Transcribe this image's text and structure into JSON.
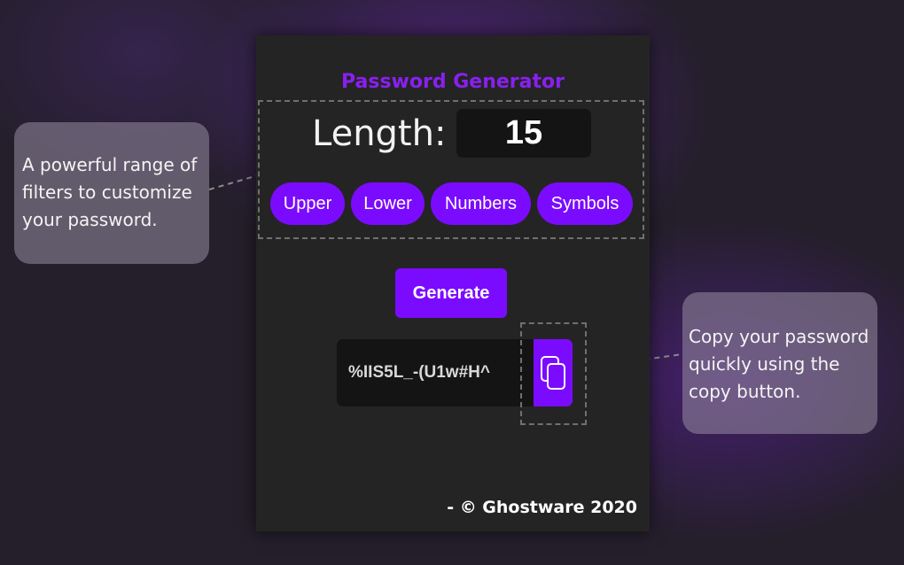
{
  "app": {
    "title": "Password Generator"
  },
  "length": {
    "label": "Length:",
    "value": "15"
  },
  "filters": [
    {
      "id": "upper",
      "label": "Upper"
    },
    {
      "id": "lower",
      "label": "Lower"
    },
    {
      "id": "numbers",
      "label": "Numbers"
    },
    {
      "id": "symbols",
      "label": "Symbols"
    }
  ],
  "generate": {
    "label": "Generate"
  },
  "password": {
    "value": "%IIS5L_-(U1w#H^"
  },
  "copy": {
    "icon": "copy-icon"
  },
  "footer": {
    "text": "- © Ghostware 2020"
  },
  "callouts": {
    "filters": "A powerful range of filters to customize your password.",
    "copy": "Copy your password quickly using the copy button."
  },
  "colors": {
    "accent": "#7b0bff",
    "title": "#8a1ff0",
    "card": "#242424",
    "field": "#141414"
  }
}
